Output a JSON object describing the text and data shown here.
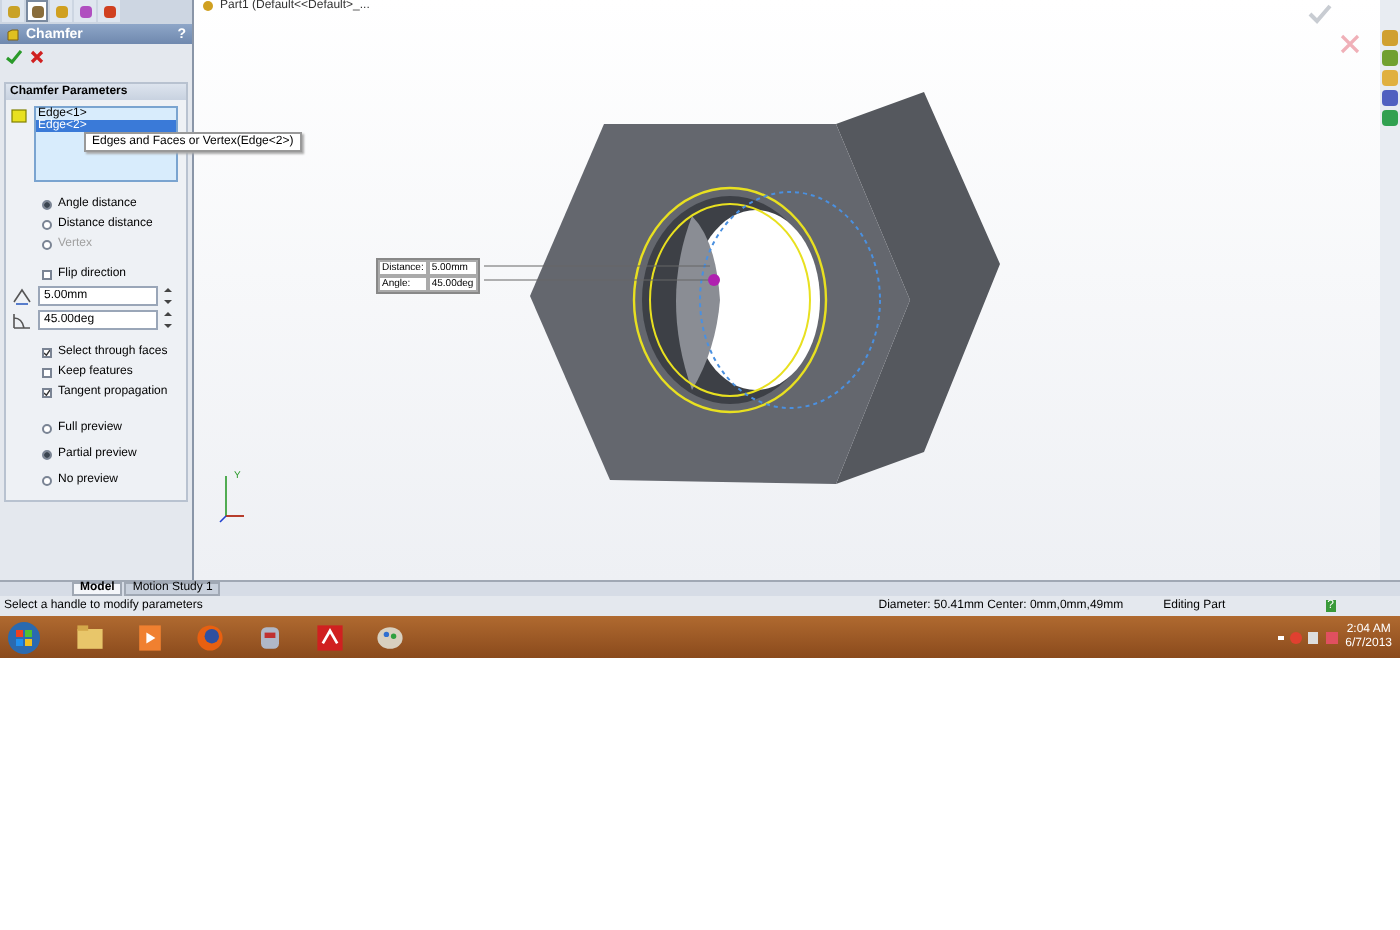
{
  "panel_tabs": [
    {
      "kind": "tree",
      "selected": false
    },
    {
      "kind": "properties",
      "selected": true
    },
    {
      "kind": "config",
      "selected": false
    },
    {
      "kind": "dim",
      "selected": false
    },
    {
      "kind": "display",
      "selected": false
    }
  ],
  "document_title": "Part1 (Default<<Default>_...",
  "panel": {
    "title": "Chamfer",
    "help": "?"
  },
  "section": {
    "title": "Chamfer Parameters"
  },
  "selection_list": [
    {
      "label": "Edge<1>",
      "selected": false
    },
    {
      "label": "Edge<2>",
      "selected": true
    }
  ],
  "tooltip": "Edges and Faces or Vertex(Edge<2>)",
  "chamfer_types": [
    {
      "label": "Angle distance",
      "selected": true,
      "disabled": false
    },
    {
      "label": "Distance distance",
      "selected": false,
      "disabled": false
    },
    {
      "label": "Vertex",
      "selected": false,
      "disabled": true
    }
  ],
  "flip_direction": {
    "label": "Flip direction",
    "checked": false
  },
  "distance_value": "5.00mm",
  "angle_value": "45.00deg",
  "options": [
    {
      "label": "Select through faces",
      "checked": true
    },
    {
      "label": "Keep features",
      "checked": false
    },
    {
      "label": "Tangent propagation",
      "checked": true
    }
  ],
  "preview": [
    {
      "label": "Full preview",
      "selected": false
    },
    {
      "label": "Partial preview",
      "selected": true
    },
    {
      "label": "No preview",
      "selected": false
    }
  ],
  "callout": [
    {
      "label": "Distance:",
      "value": "5.00mm"
    },
    {
      "label": "Angle:",
      "value": "45.00deg"
    }
  ],
  "axis_label": "Y",
  "bottom_tabs": [
    {
      "label": "Model",
      "selected": true
    },
    {
      "label": "Motion Study 1",
      "selected": false
    }
  ],
  "status_bar": {
    "message": "Select a handle to modify parameters",
    "measurement": "Diameter: 50.41mm  Center: 0mm,0mm,49mm",
    "mode": "Editing Part",
    "help": "?"
  },
  "taskbar": {
    "apps": [
      {
        "kind": "folder"
      },
      {
        "kind": "media"
      },
      {
        "kind": "browser"
      },
      {
        "kind": "tool"
      },
      {
        "kind": "cad"
      },
      {
        "kind": "paint"
      }
    ],
    "clock": {
      "time": "2:04 AM",
      "date": "6/7/2013"
    }
  }
}
